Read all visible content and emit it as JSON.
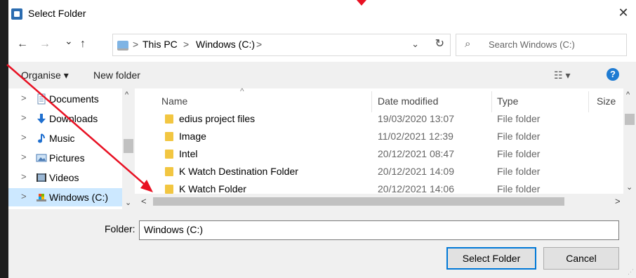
{
  "window": {
    "title": "Select Folder",
    "close_glyph": "✕"
  },
  "nav": {
    "back_glyph": "←",
    "forward_glyph": "→",
    "recent_glyph": "⌄",
    "up_glyph": "↑",
    "breadcrumbs": [
      "This PC",
      "Windows (C:)"
    ],
    "crumb_sep": ">",
    "dropdown_glyph": "⌄",
    "refresh_glyph": "↻",
    "search": {
      "icon": "search-icon",
      "placeholder": "Search Windows (C:)",
      "glyph": "⌕"
    }
  },
  "toolbar": {
    "organise": "Organise ▾",
    "new_folder": "New folder",
    "view_glyph": "☷ ▾",
    "help_glyph": "?"
  },
  "tree": {
    "items": [
      {
        "label": "Documents",
        "icon": "documents-icon",
        "arrow": ">"
      },
      {
        "label": "Downloads",
        "icon": "downloads-icon",
        "arrow": ">"
      },
      {
        "label": "Music",
        "icon": "music-icon",
        "arrow": ">"
      },
      {
        "label": "Pictures",
        "icon": "pictures-icon",
        "arrow": ">"
      },
      {
        "label": "Videos",
        "icon": "videos-icon",
        "arrow": ">"
      },
      {
        "label": "Windows (C:)",
        "icon": "drive-icon",
        "arrow": ">",
        "selected": true
      }
    ]
  },
  "file_list": {
    "columns": [
      "Name",
      "Date modified",
      "Type",
      "Size"
    ],
    "sort_indicator": "^",
    "rows": [
      {
        "name": "edius project files",
        "date": "19/03/2020 13:07",
        "type": "File folder"
      },
      {
        "name": "Image",
        "date": "11/02/2021 12:39",
        "type": "File folder"
      },
      {
        "name": "Intel",
        "date": "20/12/2021 08:47",
        "type": "File folder"
      },
      {
        "name": "K Watch Destination Folder",
        "date": "20/12/2021 14:09",
        "type": "File folder"
      },
      {
        "name": "K Watch Folder",
        "date": "20/12/2021 14:06",
        "type": "File folder"
      }
    ]
  },
  "footer": {
    "folder_label": "Folder:",
    "folder_value": "Windows (C:)",
    "select_button": "Select Folder",
    "cancel_button": "Cancel"
  },
  "colors": {
    "accent": "#0078d7",
    "selection": "#cce8ff",
    "annotation_arrow": "#e81123",
    "folder": "#f2c641"
  }
}
